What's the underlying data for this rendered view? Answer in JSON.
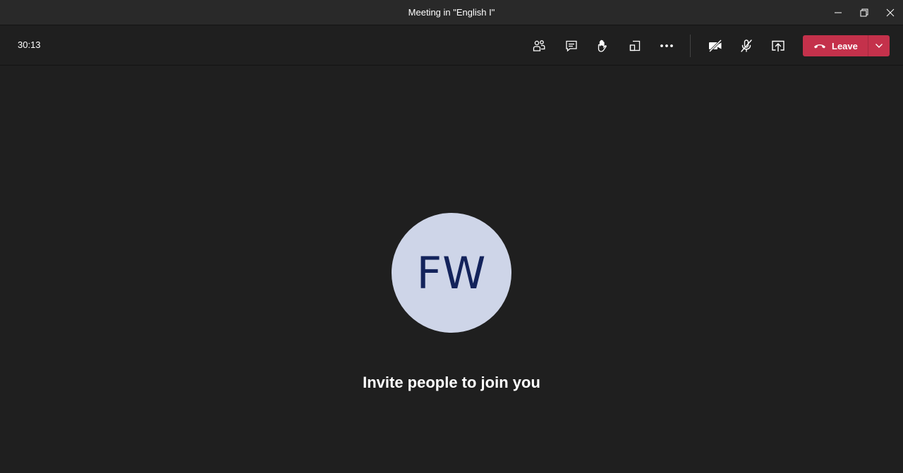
{
  "window": {
    "title": "Meeting in \"English I\"",
    "controls": [
      "minimize-icon",
      "restore-icon",
      "close-icon"
    ]
  },
  "toolbar": {
    "timer": "30:13",
    "icons": [
      "participants-icon",
      "chat-icon",
      "raise-hand-icon",
      "rooms-icon",
      "more-icon",
      "camera-off-icon",
      "mic-off-icon",
      "share-screen-icon"
    ],
    "leave_label": "Leave",
    "leave_color": "#c4314b"
  },
  "stage": {
    "avatar_initials": "FW",
    "avatar_bg": "#ced5e8",
    "avatar_fg": "#13235b",
    "invite_text": "Invite people to join you"
  }
}
